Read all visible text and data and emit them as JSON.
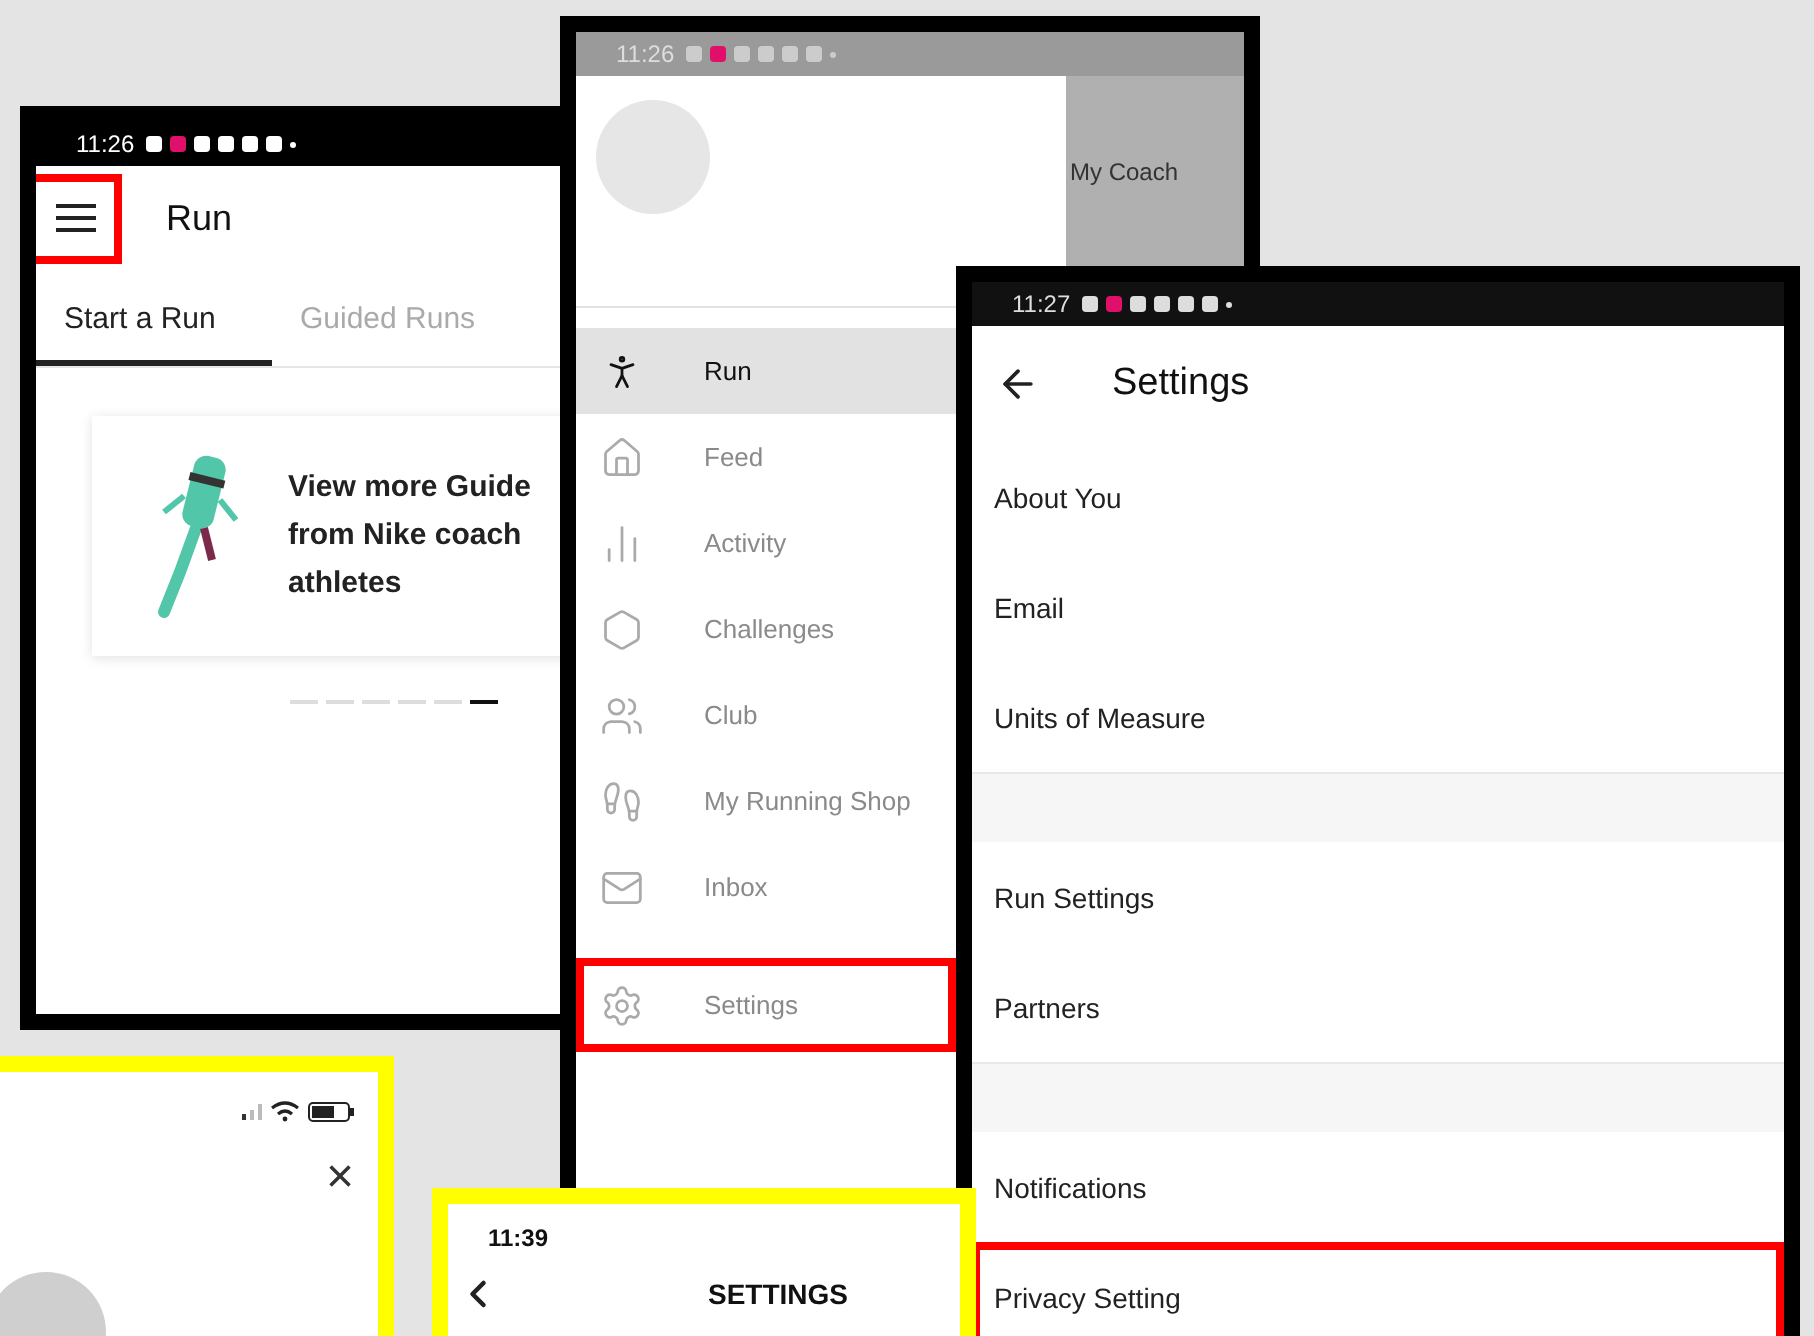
{
  "run_screen": {
    "status_time": "11:26",
    "menu_button": {
      "highlighted": true
    },
    "title": "Run",
    "tabs": [
      {
        "label": "Start a Run",
        "selected": true
      },
      {
        "label": "Guided Runs",
        "selected": false
      }
    ],
    "card": {
      "lines": [
        "View more Guide",
        "from Nike coach",
        "athletes"
      ]
    },
    "pages": [
      {
        "selected": false
      },
      {
        "selected": false
      },
      {
        "selected": false
      },
      {
        "selected": false
      },
      {
        "selected": false
      },
      {
        "selected": true
      }
    ]
  },
  "drawer_screen": {
    "status_time": "11:26",
    "coach_label": "My Coach",
    "items": [
      {
        "label": "Run",
        "selected": true,
        "highlighted": false
      },
      {
        "label": "Feed",
        "selected": false,
        "highlighted": false
      },
      {
        "label": "Activity",
        "selected": false,
        "highlighted": false
      },
      {
        "label": "Challenges",
        "selected": false,
        "highlighted": false
      },
      {
        "label": "Club",
        "selected": false,
        "highlighted": false
      },
      {
        "label": "My Running Shop",
        "selected": false,
        "highlighted": false
      },
      {
        "label": "Inbox",
        "selected": false,
        "highlighted": false
      },
      {
        "label": "Settings",
        "selected": false,
        "highlighted": true
      }
    ]
  },
  "settings_screen": {
    "status_time": "11:27",
    "title": "Settings",
    "sections": [
      [
        {
          "label": "About You",
          "highlighted": false
        },
        {
          "label": "Email",
          "highlighted": false
        },
        {
          "label": "Units of Measure",
          "highlighted": false
        }
      ],
      [
        {
          "label": "Run Settings",
          "highlighted": false
        },
        {
          "label": "Partners",
          "highlighted": false
        }
      ],
      [
        {
          "label": "Notifications",
          "highlighted": false
        },
        {
          "label": "Privacy Setting",
          "highlighted": true
        }
      ]
    ]
  },
  "ios_profile_screen": {
    "close": "×"
  },
  "ios_settings_screen": {
    "status_time": "11:39",
    "title": "SETTINGS"
  }
}
